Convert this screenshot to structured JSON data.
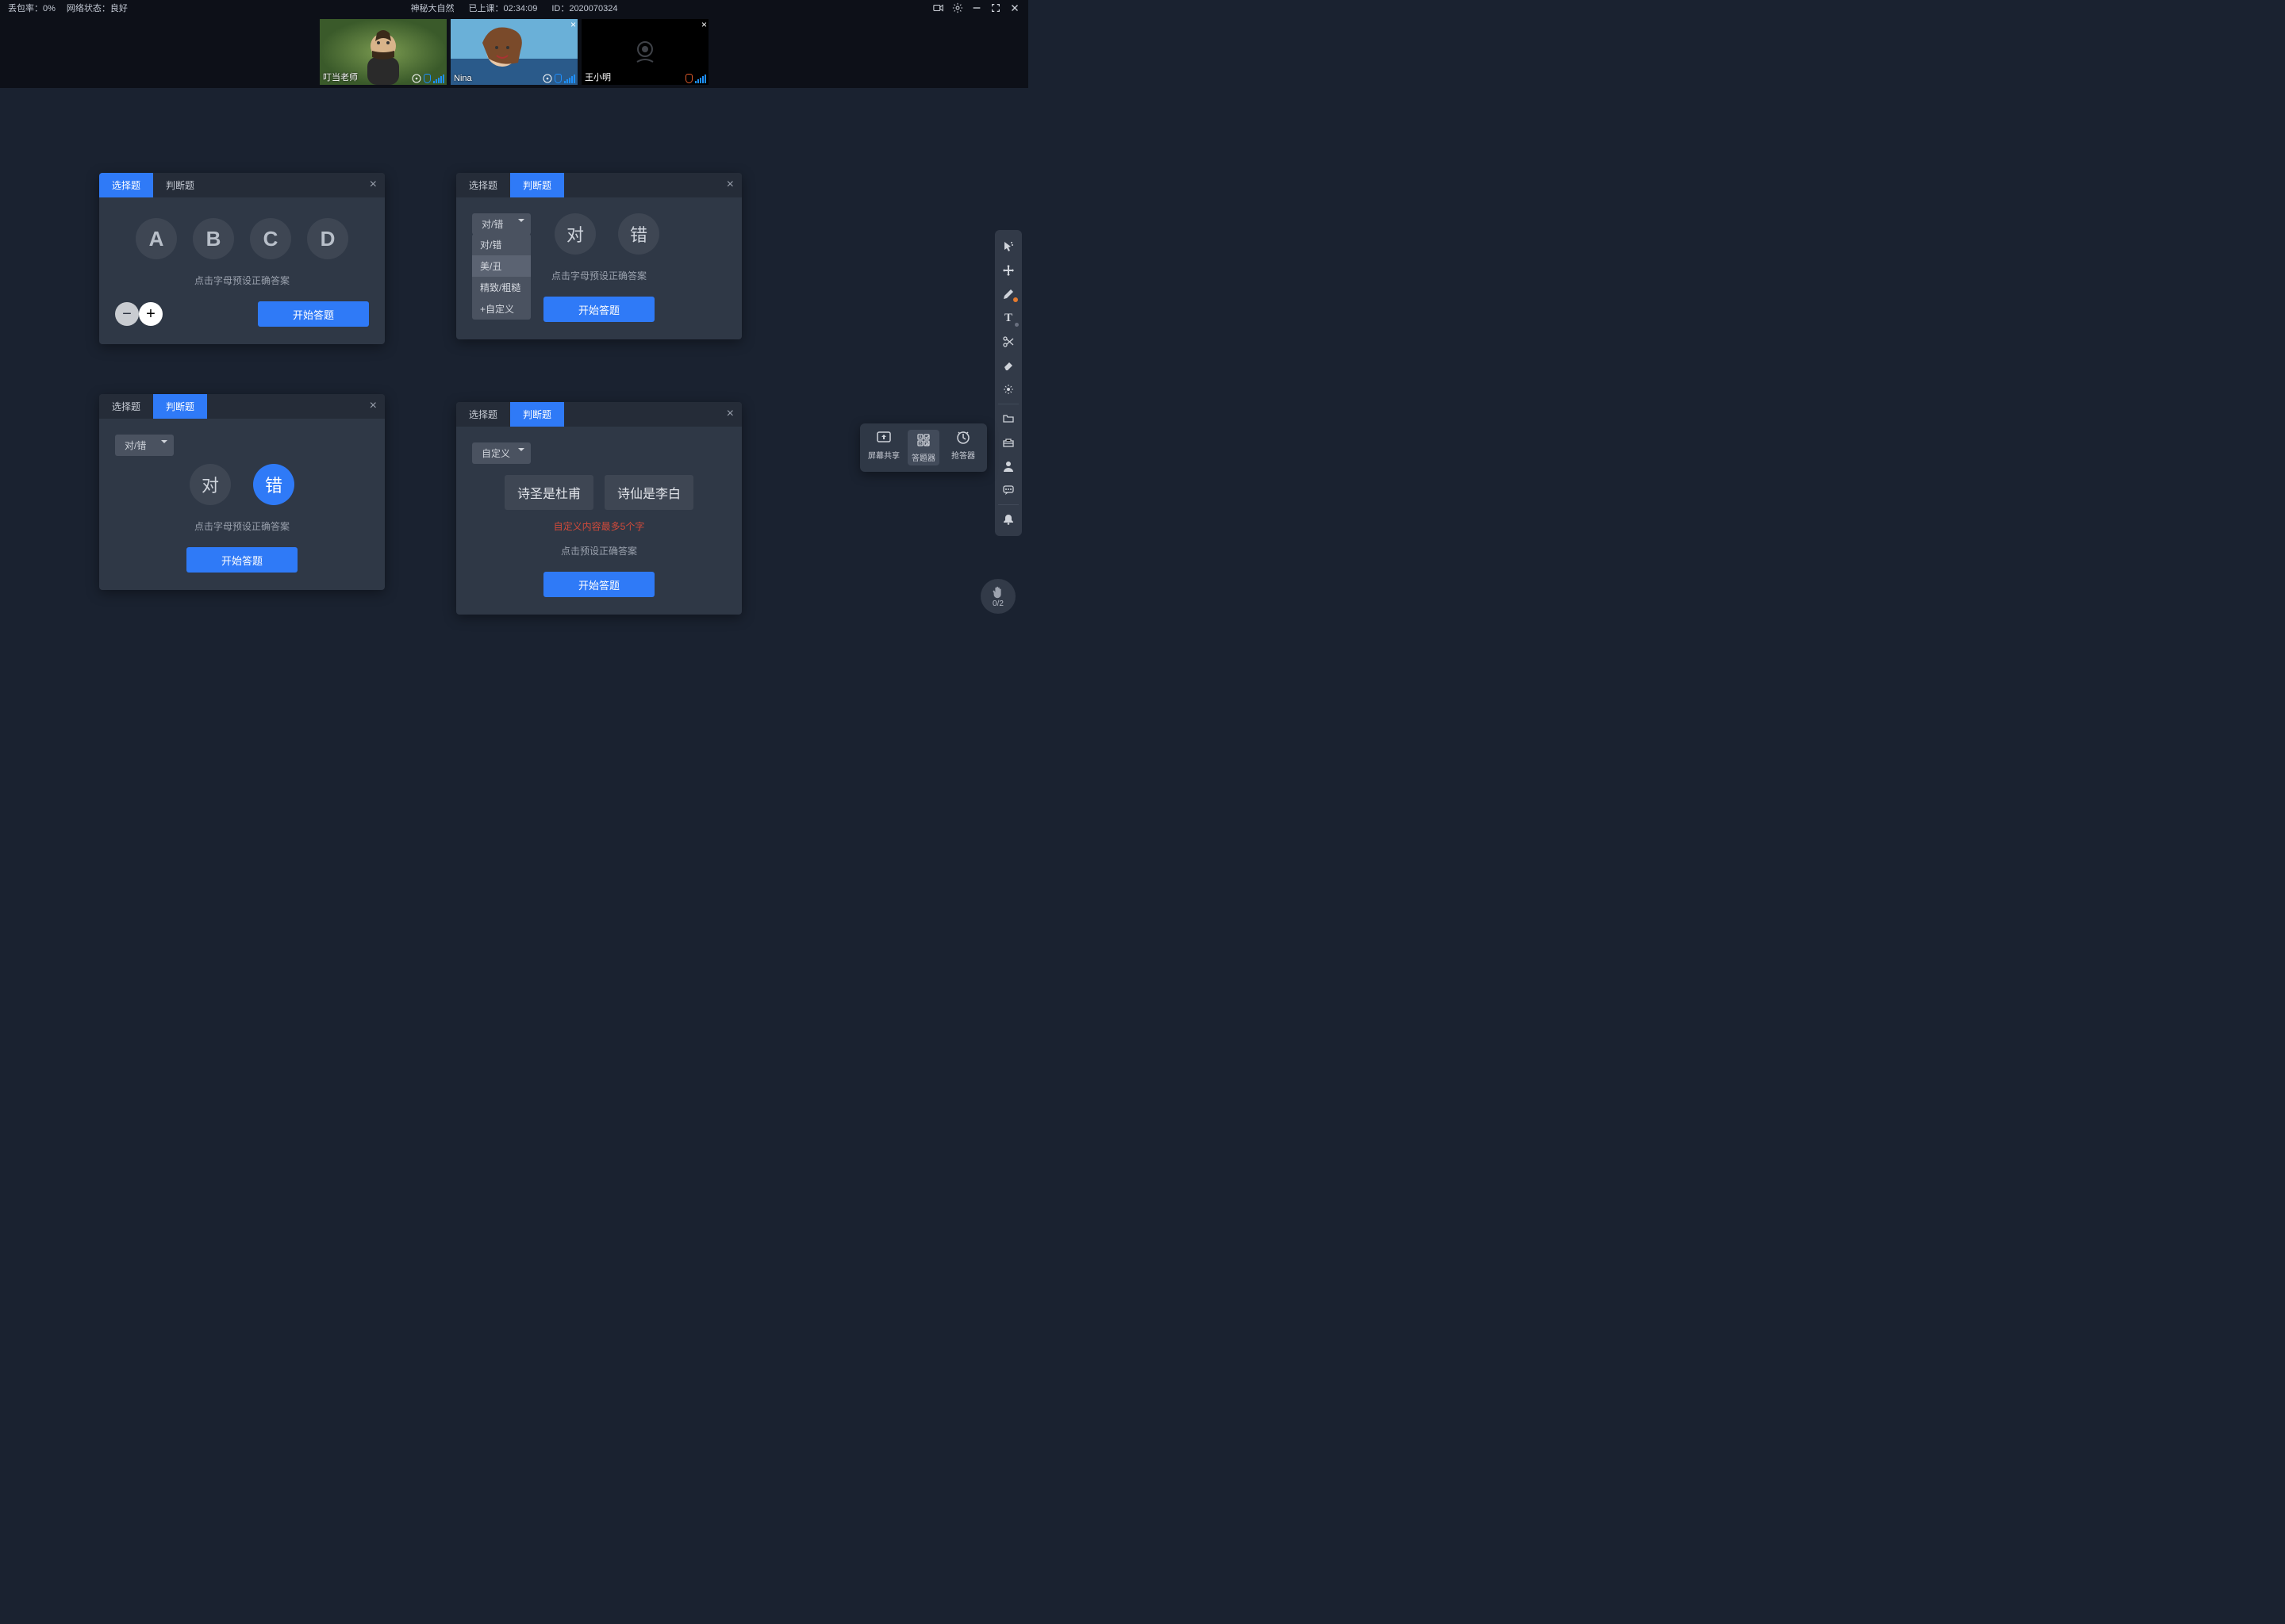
{
  "topbar": {
    "loss_rate_label": "丢包率：0%",
    "net_label": "网络状态：良好",
    "title": "神秘大自然",
    "elapsed_label": "已上课：",
    "elapsed": "02:34:09",
    "id_label": "ID：",
    "id": "2020070324"
  },
  "videos": [
    {
      "name": "叮当老师",
      "cam": true,
      "mic": "on",
      "closeable": false,
      "bg": "linear-gradient(120deg,#4a7a3a,#8fae5a)"
    },
    {
      "name": "Nina",
      "cam": true,
      "mic": "on",
      "closeable": true,
      "bg": "linear-gradient(110deg,#2a6ea8,#8fbfe0)"
    },
    {
      "name": "王小明",
      "cam": false,
      "mic": "muted",
      "closeable": true,
      "bg": "#000"
    }
  ],
  "common": {
    "tab_choice": "选择题",
    "tab_tf": "判断题",
    "hint_preset": "点击字母预设正确答案",
    "hint_preset2": "点击预设正确答案",
    "start": "开始答题"
  },
  "panel1": {
    "letters": [
      "A",
      "B",
      "C",
      "D"
    ]
  },
  "panel2": {
    "dd_selected": "对/错",
    "dd_items": [
      "对/错",
      "美/丑",
      "精致/粗糙",
      "+自定义"
    ],
    "dd_sel_index": 1,
    "tf": [
      "对",
      "错"
    ]
  },
  "panel3": {
    "dd_selected": "对/错",
    "tf": [
      "对",
      "错"
    ],
    "selected": "错"
  },
  "panel4": {
    "dd_selected": "自定义",
    "buttons": [
      "诗圣是杜甫",
      "诗仙是李白"
    ],
    "error": "自定义内容最多5个字"
  },
  "poprow": {
    "share": "屏幕共享",
    "answer": "答题器",
    "buzz": "抢答器"
  },
  "hand": {
    "count": "0/2"
  }
}
